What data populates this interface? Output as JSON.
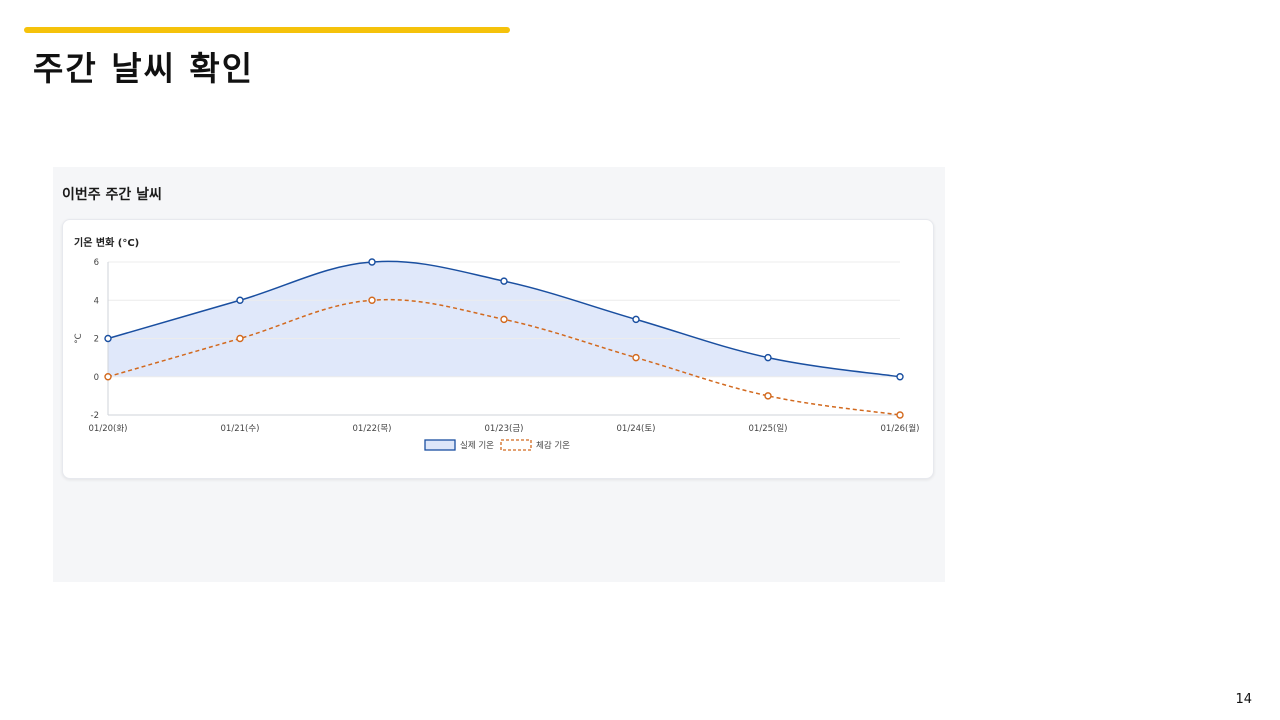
{
  "slide": {
    "title": "주간 날씨 확인",
    "page_number": "14"
  },
  "colors": {
    "accent_bar": "#f5c20b",
    "actual_line": "#1a4fa0",
    "actual_fill": "#dde6f9",
    "feels_line": "#d2691e",
    "panel_bg": "#f5f6f8"
  },
  "panel": {
    "title": "이번주 주간 날씨"
  },
  "card": {
    "title": "기온 변화 (°C)"
  },
  "chart_data": {
    "type": "line",
    "title": "기온 변화 (°C)",
    "ylabel": "°C",
    "xlabel": "",
    "categories": [
      "01/20(화)",
      "01/21(수)",
      "01/22(목)",
      "01/23(금)",
      "01/24(토)",
      "01/25(일)",
      "01/26(월)"
    ],
    "yticks": [
      6,
      4,
      2,
      0,
      -2
    ],
    "ylim": [
      -2,
      6
    ],
    "grid": true,
    "legend_position": "bottom-center",
    "series": [
      {
        "name": "실제 기온",
        "values": [
          2,
          4,
          6,
          5,
          3,
          1,
          0
        ],
        "style": "solid",
        "fill": true,
        "color": "#1a4fa0"
      },
      {
        "name": "체감 기온",
        "values": [
          0,
          2,
          4,
          3,
          1,
          -1,
          -2
        ],
        "style": "dashed",
        "fill": false,
        "color": "#d2691e"
      }
    ]
  }
}
